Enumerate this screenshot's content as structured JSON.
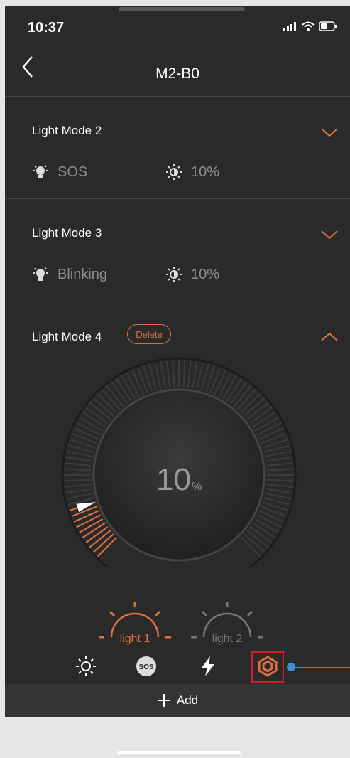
{
  "status": {
    "time": "10:37"
  },
  "nav": {
    "title": "M2-B0"
  },
  "modes": [
    {
      "title": "Light Mode 2",
      "type": "SOS",
      "brightness": "10%"
    },
    {
      "title": "Light Mode 3",
      "type": "Blinking",
      "brightness": "10%"
    },
    {
      "title": "Light Mode 4",
      "delete_label": "Delete"
    }
  ],
  "dial": {
    "value": "10",
    "unit": "%",
    "level": 0.1
  },
  "light_tabs": [
    "light 1",
    "light 2"
  ],
  "mode_icons": [
    "sun-icon",
    "sos-icon",
    "lightning-icon",
    "hexagon-spiral-icon"
  ],
  "add": {
    "label": "Add"
  },
  "colors": {
    "accent": "#e07040",
    "background": "#2a2a2a",
    "pointer": "#3a8fd6"
  }
}
